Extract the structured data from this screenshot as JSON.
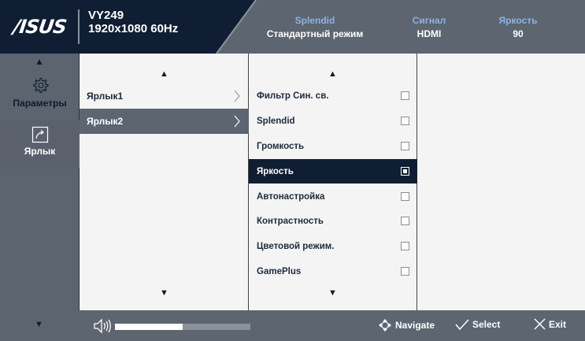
{
  "header": {
    "logo": "/ISUS",
    "model": "VY249",
    "resolution": "1920x1080 60Hz",
    "stats": [
      {
        "label": "Splendid",
        "value": "Стандартный режим"
      },
      {
        "label": "Сигнал",
        "value": "HDMI"
      },
      {
        "label": "Яркость",
        "value": "90"
      }
    ]
  },
  "sidebar": {
    "items": [
      {
        "label": "Параметры",
        "icon": "gear-icon",
        "selected": false
      },
      {
        "label": "Ярлык",
        "icon": "shortcut-icon",
        "selected": true
      }
    ]
  },
  "submenu": {
    "items": [
      {
        "label": "Ярлык1",
        "selected": false
      },
      {
        "label": "Ярлык2",
        "selected": true
      }
    ]
  },
  "options": {
    "items": [
      {
        "label": "Фильтр Син. св.",
        "checked": false
      },
      {
        "label": "Splendid",
        "checked": false
      },
      {
        "label": "Громкость",
        "checked": false
      },
      {
        "label": "Яркость",
        "checked": true
      },
      {
        "label": "Автонастройка",
        "checked": false
      },
      {
        "label": "Контрастность",
        "checked": false
      },
      {
        "label": "Цветовой режим.",
        "checked": false
      },
      {
        "label": "GamePlus",
        "checked": false
      }
    ]
  },
  "footer": {
    "volume_level": 0.5,
    "navigate": "Navigate",
    "select": "Select",
    "exit": "Exit"
  },
  "colors": {
    "header_dark": "#0f1e33",
    "panel_gray": "#5c6570",
    "selected_row": "#0f1e33",
    "accent_label": "#8fb3e0"
  }
}
